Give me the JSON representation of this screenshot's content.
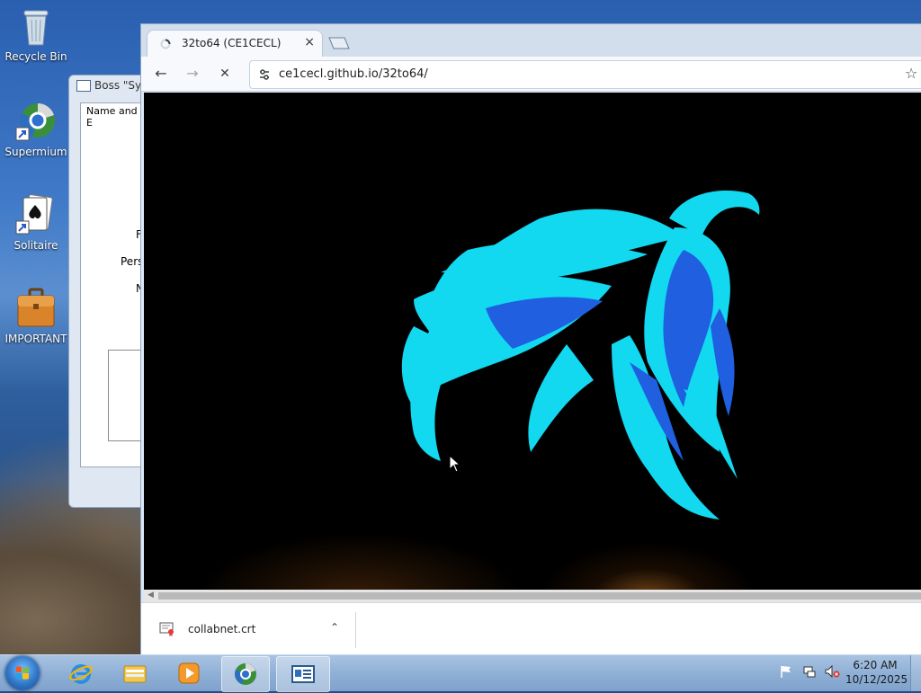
{
  "desktop": {
    "icons": [
      {
        "label": "Recycle Bin",
        "icon": "recycle-bin-icon"
      },
      {
        "label": "Supermium",
        "icon": "supermium-icon"
      },
      {
        "label": "Solitaire",
        "icon": "solitaire-icon"
      },
      {
        "label": "IMPORTANT",
        "icon": "briefcase-icon"
      }
    ]
  },
  "boss_window": {
    "title": "Boss \"Sys",
    "panel_header": "Name and E",
    "fragments": [
      "F",
      "Pers",
      "N"
    ]
  },
  "browser": {
    "tab": {
      "title": "32to64 (CE1CECL)",
      "close": "×"
    },
    "nav": {
      "back": "←",
      "forward": "→",
      "stop": "✕"
    },
    "url": "ce1cecl.github.io/32to64/",
    "star": "☆",
    "downloads": [
      {
        "name": "collabnet.crt",
        "chevron": "⌃"
      }
    ]
  },
  "taskbar": {
    "apps": [
      {
        "name": "internet-explorer-icon",
        "active": false
      },
      {
        "name": "file-explorer-icon",
        "active": false
      },
      {
        "name": "media-player-icon",
        "active": false
      },
      {
        "name": "supermium-icon",
        "active": true
      },
      {
        "name": "boss-app-icon",
        "active": true
      }
    ],
    "time": "6:20 AM",
    "date": "10/12/2025"
  },
  "colors": {
    "phoenix_cyan": "#12d8f0",
    "phoenix_blue": "#1f5fe0",
    "page_background": "#000000"
  }
}
